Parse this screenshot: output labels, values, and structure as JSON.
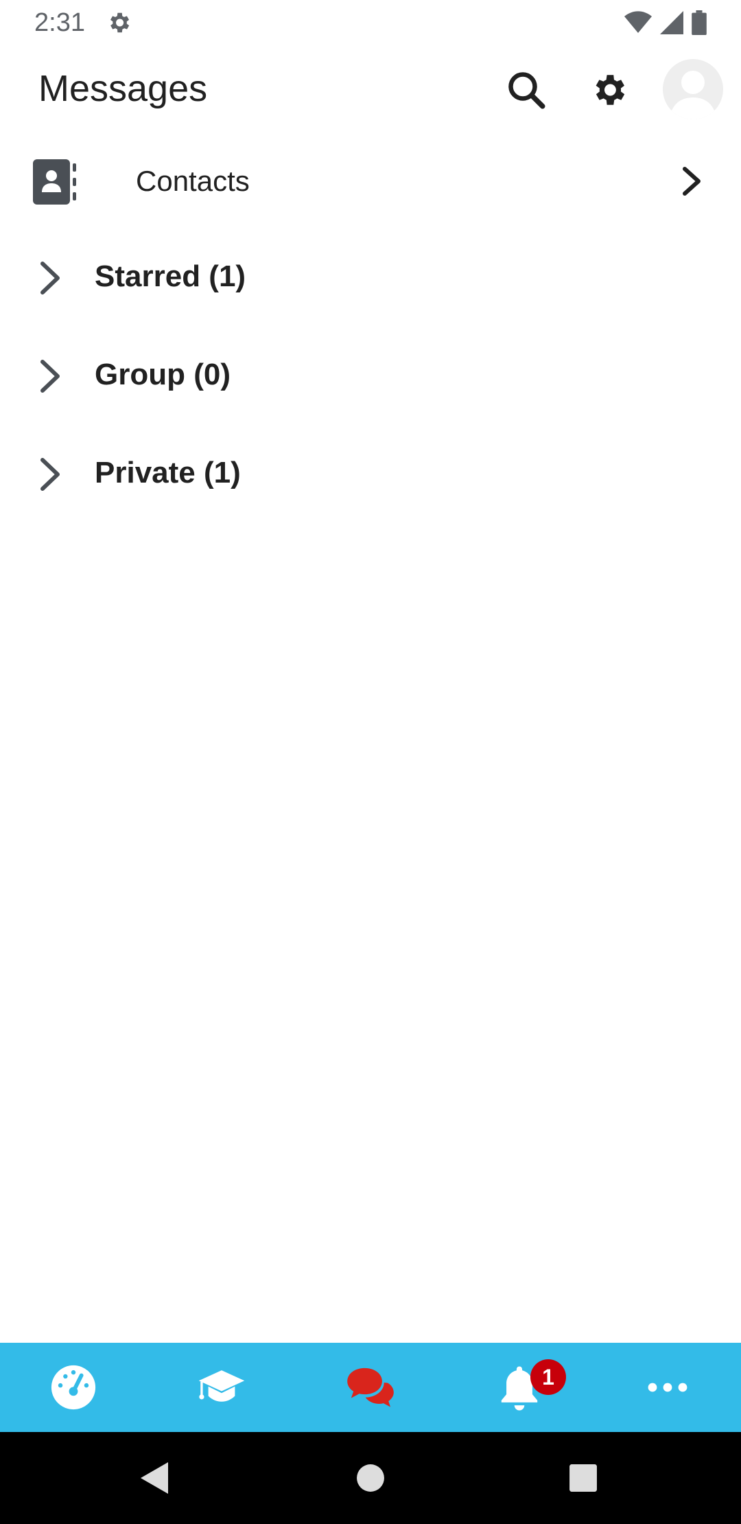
{
  "status_bar": {
    "time": "2:31",
    "icons": [
      "settings-icon",
      "wifi-icon",
      "signal-icon",
      "battery-icon"
    ]
  },
  "app_bar": {
    "title": "Messages",
    "actions": [
      "search-icon",
      "gear-icon",
      "avatar"
    ]
  },
  "contacts": {
    "label": "Contacts",
    "icon": "contacts-book-icon"
  },
  "groups": [
    {
      "label": "Starred (1)"
    },
    {
      "label": "Group (0)"
    },
    {
      "label": "Private (1)"
    }
  ],
  "bottom_nav": {
    "items": [
      "dashboard-icon",
      "courses-icon",
      "messages-icon",
      "notifications-icon",
      "more-icon"
    ],
    "active": "messages",
    "notifications_badge": "1"
  },
  "colors": {
    "accent": "#33bbe8",
    "active_icon": "#d9251c",
    "badge": "#c7000a",
    "text": "#212121"
  }
}
